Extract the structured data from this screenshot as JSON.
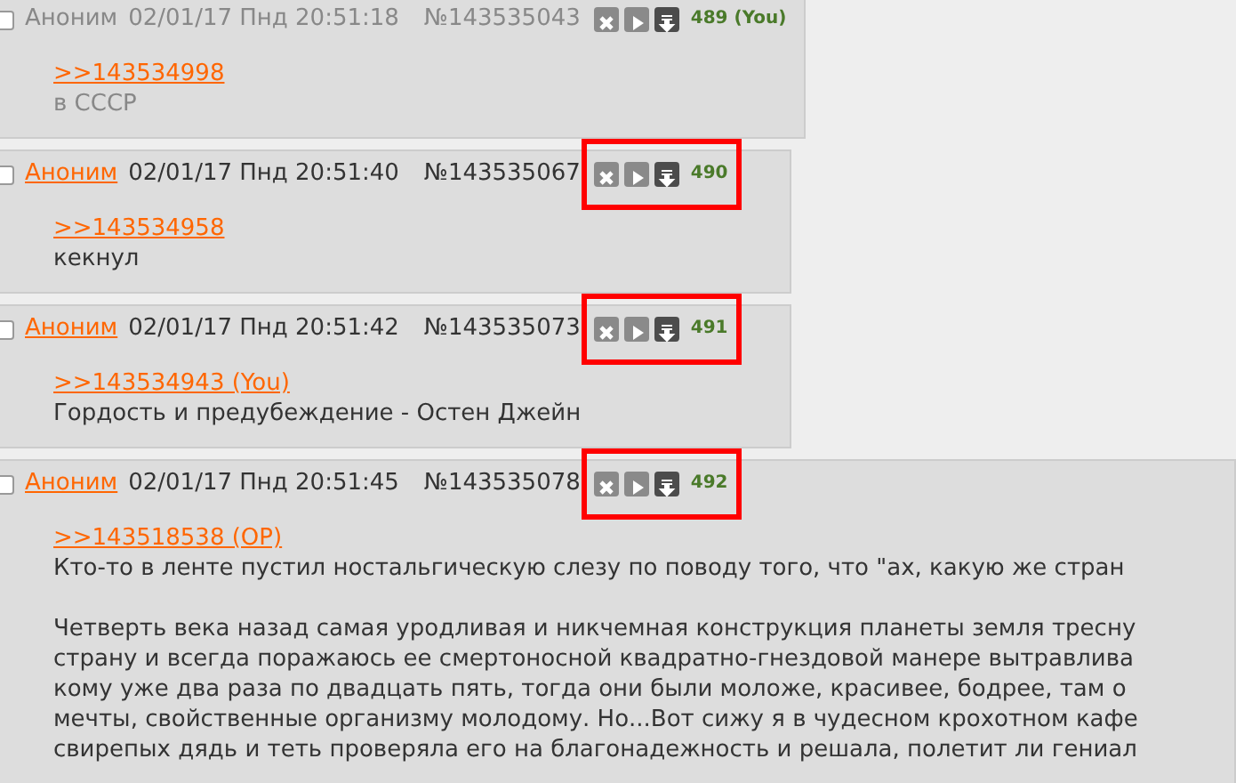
{
  "posts": [
    {
      "checked": false,
      "faded": true,
      "highlighted": false,
      "author": "Аноним",
      "date": "02/01/17 Пнд 20:51:18",
      "number": "№143535043",
      "index": "489 (You)",
      "reply_link": ">>143534998",
      "paragraphs": [
        [
          "в СССР"
        ]
      ]
    },
    {
      "checked": false,
      "faded": false,
      "highlighted": true,
      "author": "Аноним",
      "date": "02/01/17 Пнд 20:51:40",
      "number": "№143535067",
      "index": "490",
      "reply_link": ">>143534958",
      "paragraphs": [
        [
          "кекнул"
        ]
      ]
    },
    {
      "checked": false,
      "faded": false,
      "highlighted": true,
      "author": "Аноним",
      "date": "02/01/17 Пнд 20:51:42",
      "number": "№143535073",
      "index": "491",
      "reply_link": ">>143534943 (You)",
      "paragraphs": [
        [
          "Гордость и предубеждение - Остен Джейн"
        ]
      ]
    },
    {
      "checked": false,
      "faded": false,
      "highlighted": true,
      "author": "Аноним",
      "date": "02/01/17 Пнд 20:51:45",
      "number": "№143535078",
      "index": "492",
      "reply_link": ">>143518538 (OP)",
      "paragraphs": [
        [
          "Кто-то в ленте пустил ностальгическую слезу по поводу того, что \"ах, какую же стран"
        ],
        [
          "Четверть века назад самая уродливая и никчемная конструкция планеты земля тресну",
          "страну и всегда поражаюсь ее смертоносной квадратно-гнездовой манере вытравлива",
          "кому уже два раза по двадцать пять, тогда они были моложе, красивее, бодрее, там о",
          "мечты, свойственные организму молодому. Но...Вот сижу я в чудесном крохотном кафе",
          "свирепых дядь и теть проверяла его на благонадежность и решала, полетит ли гениал"
        ]
      ]
    }
  ]
}
